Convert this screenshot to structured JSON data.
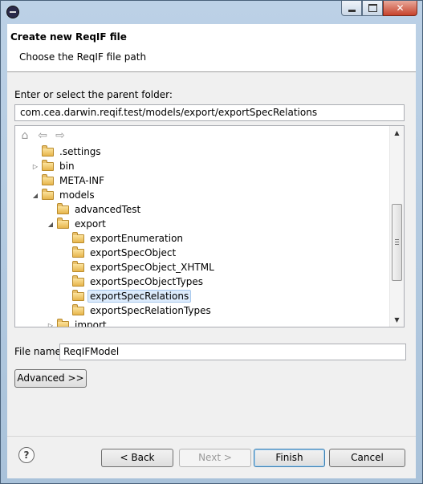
{
  "dialog": {
    "title": "Create new ReqIF file",
    "subtitle": "Choose the ReqIF file path"
  },
  "folder": {
    "label": "Enter or select the parent folder:",
    "path": "com.cea.darwin.reqif.test/models/export/exportSpecRelations"
  },
  "tree": {
    "items": [
      {
        "label": ".settings",
        "depth": 1,
        "twisty": "none"
      },
      {
        "label": "bin",
        "depth": 1,
        "twisty": "collapsed"
      },
      {
        "label": "META-INF",
        "depth": 1,
        "twisty": "none"
      },
      {
        "label": "models",
        "depth": 1,
        "twisty": "expanded"
      },
      {
        "label": "advancedTest",
        "depth": 2,
        "twisty": "none"
      },
      {
        "label": "export",
        "depth": 2,
        "twisty": "expanded"
      },
      {
        "label": "exportEnumeration",
        "depth": 3,
        "twisty": "none"
      },
      {
        "label": "exportSpecObject",
        "depth": 3,
        "twisty": "none"
      },
      {
        "label": "exportSpecObject_XHTML",
        "depth": 3,
        "twisty": "none"
      },
      {
        "label": "exportSpecObjectTypes",
        "depth": 3,
        "twisty": "none"
      },
      {
        "label": "exportSpecRelations",
        "depth": 3,
        "twisty": "none",
        "selected": true
      },
      {
        "label": "exportSpecRelationTypes",
        "depth": 3,
        "twisty": "none"
      },
      {
        "label": "import",
        "depth": 2,
        "twisty": "collapsed"
      }
    ],
    "toolbar_icons": [
      "home-icon",
      "back-arrow-icon",
      "forward-arrow-icon"
    ]
  },
  "file": {
    "label": "File name:",
    "value": "ReqIFModel"
  },
  "buttons": {
    "advanced": "Advanced >>",
    "help": "?",
    "back": "< Back",
    "next": "Next >",
    "finish": "Finish",
    "cancel": "Cancel"
  },
  "colors": {
    "selection": "#dcebfc",
    "folder": "#e7b54c",
    "frame": "#bcd1e6",
    "close": "#c7432c"
  }
}
